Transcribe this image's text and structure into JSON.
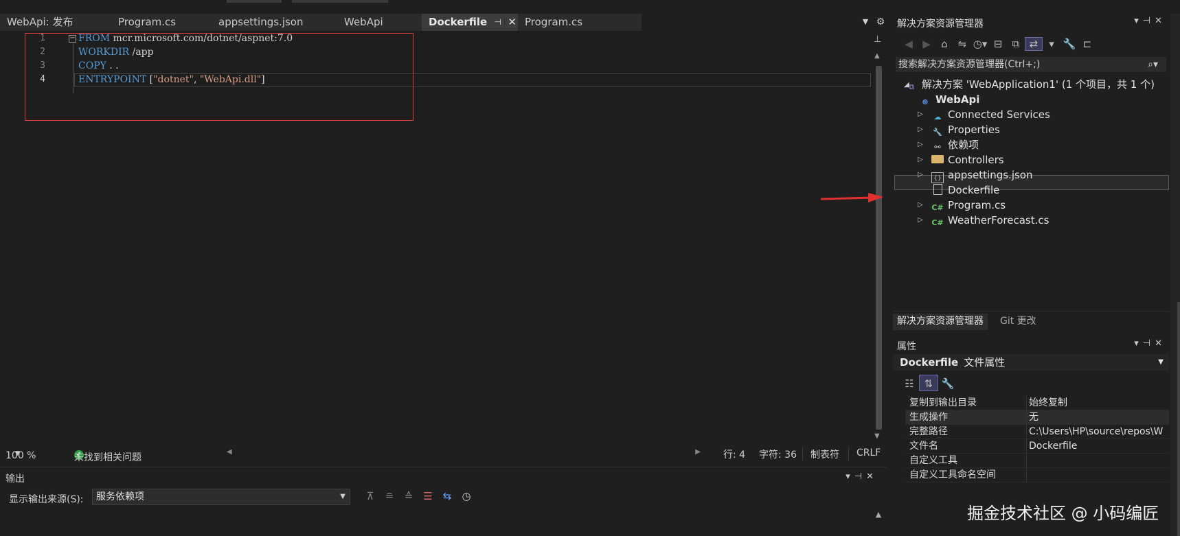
{
  "tabs": [
    {
      "label": "WebApi: 发布"
    },
    {
      "label": "Program.cs"
    },
    {
      "label": "appsettings.json"
    },
    {
      "label": "WebApi"
    },
    {
      "label": "Dockerfile",
      "pin": "⊣",
      "close": "✕"
    },
    {
      "label": "Program.cs"
    }
  ],
  "editor": {
    "line_numbers": [
      "1",
      "2",
      "3",
      "4"
    ],
    "lines": [
      {
        "kw": "FROM",
        "rest": " mcr.microsoft.com/dotnet/aspnet:7.0"
      },
      {
        "kw": "WORKDIR",
        "rest": " /app"
      },
      {
        "kw": "COPY",
        "rest": " . ."
      },
      {
        "kw": "ENTRYPOINT",
        "rest_a": " [",
        "s1": "\"dotnet\"",
        "rest_b": ", ",
        "s2": "\"WebApi.dll\"",
        "rest_c": "]"
      }
    ],
    "fold_glyph": "−"
  },
  "status": {
    "zoom": "100 %",
    "issues": "未找到相关问题",
    "line": "行: 4",
    "char": "字符: 36",
    "tabs_mode": "制表符",
    "eol": "CRLF"
  },
  "output": {
    "title": "输出",
    "source_label": "显示输出来源(S):",
    "source_value": "服务依赖项"
  },
  "solution_explorer": {
    "title": "解决方案资源管理器",
    "search_placeholder": "搜索解决方案资源管理器(Ctrl+;)",
    "solution": "解决方案 'WebApplication1' (1 个项目，共 1 个)",
    "project": "WebApi",
    "items": [
      {
        "label": "Connected Services",
        "icon": "connected-services-icon"
      },
      {
        "label": "Properties",
        "icon": "properties-icon"
      },
      {
        "label": "依赖项",
        "icon": "dependencies-icon"
      },
      {
        "label": "Controllers",
        "icon": "folder-icon"
      },
      {
        "label": "appsettings.json",
        "icon": "json-file-icon"
      },
      {
        "label": "Dockerfile",
        "icon": "file-icon"
      },
      {
        "label": "Program.cs",
        "icon": "csharp-file-icon"
      },
      {
        "label": "WeatherForecast.cs",
        "icon": "csharp-file-icon"
      }
    ],
    "bottom_tabs": [
      "解决方案资源管理器",
      "Git 更改"
    ]
  },
  "properties": {
    "title": "属性",
    "object_name": "Dockerfile",
    "object_type": "文件属性",
    "rows": [
      {
        "key": "复制到输出目录",
        "value": "始终复制"
      },
      {
        "key": "生成操作",
        "value": "无"
      },
      {
        "key": "完整路径",
        "value": "C:\\Users\\HP\\source\\repos\\W"
      },
      {
        "key": "文件名",
        "value": "Dockerfile"
      },
      {
        "key": "自定义工具",
        "value": ""
      },
      {
        "key": "自定义工具命名空间",
        "value": ""
      }
    ]
  },
  "watermark": "掘金技术社区 @ 小码编匠",
  "colors": {
    "keyword": "#569cd6",
    "string": "#d69d85",
    "annotation_red": "#e03030"
  }
}
